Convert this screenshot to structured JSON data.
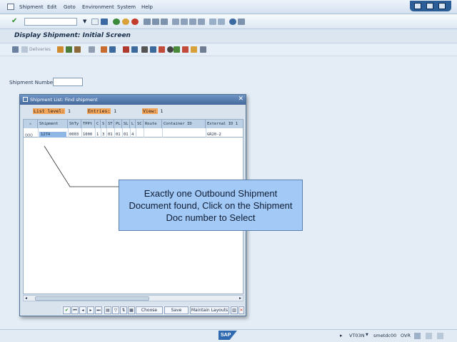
{
  "menubar": {
    "items": [
      "Shipment",
      "Edit",
      "Goto",
      "Environment",
      "System",
      "Help"
    ]
  },
  "title": "Display Shipment: Initial Screen",
  "app_toolbar": {
    "deliveries_label": "Deliveries"
  },
  "shipment_field": {
    "label": "Shipment Number",
    "value": ""
  },
  "dialog": {
    "title": "Shipment List: Find shipment",
    "list_level_label": "List level:",
    "list_level_value": "1",
    "entries_label": "Entries:",
    "entries_value": "1",
    "view_label": "View:",
    "view_value": "1",
    "columns": [
      "Shipment",
      "ShTy",
      "TPPt",
      "C",
      "S",
      "ST",
      "PL",
      "SL",
      "L",
      "SC",
      "Route",
      "Container ID",
      "External ID 1"
    ],
    "row": {
      "shipment": "1274",
      "shty": "0003",
      "tppt": "1000",
      "c": "1",
      "s": "3",
      "st": "01",
      "pl": "01",
      "sl": "01",
      "l": "4",
      "sc": "",
      "route": "",
      "container_id": "",
      "external_id": "GR20-2"
    },
    "footer": {
      "choose": "Choose",
      "save": "Save",
      "maintain_layouts": "Maintain Layouts"
    }
  },
  "callout": "Exactly one Outbound Shipment Document found, Click on the Shipment Doc number to Select",
  "statusbar": {
    "transaction": "VT03N",
    "server": "smetdc00",
    "mode": "OVR"
  },
  "colors": {
    "accent": "#44699c",
    "highlight": "#f3a55a",
    "callout": "#a3c9f7"
  }
}
